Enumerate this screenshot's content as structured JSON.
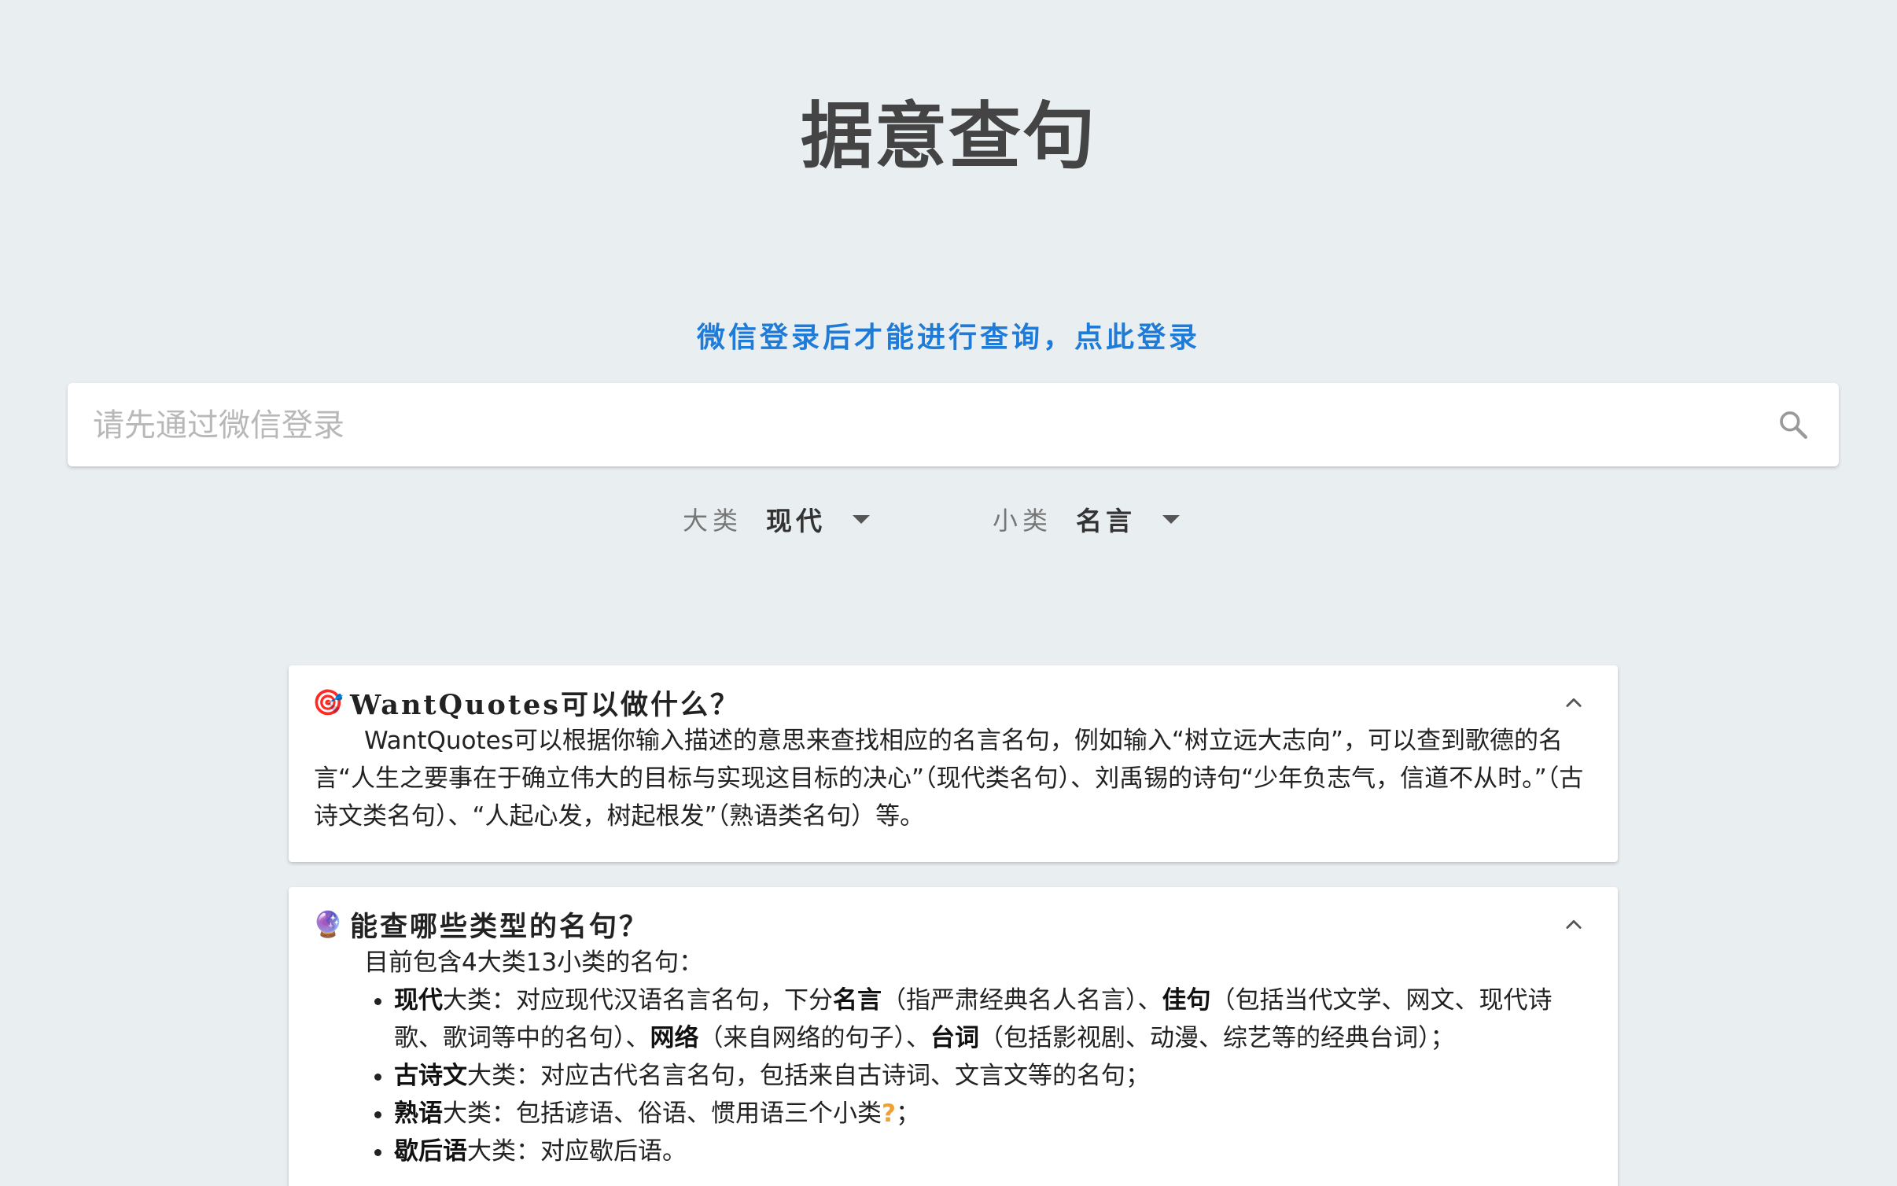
{
  "header": {
    "title": "据意查句",
    "login_prompt": "微信登录后才能进行查询，点此登录"
  },
  "search": {
    "placeholder": "请先通过微信登录",
    "value": ""
  },
  "filters": {
    "category": {
      "label": "大类",
      "value": "现代"
    },
    "subcategory": {
      "label": "小类",
      "value": "名言"
    }
  },
  "cards": {
    "what": {
      "emoji": "🎯",
      "title": "WantQuotes可以做什么？",
      "body": "WantQuotes可以根据你输入描述的意思来查找相应的名言名句，例如输入“树立远大志向”，可以查到歌德的名言“人生之要事在于确立伟大的目标与实现这目标的决心”（现代类名句）、刘禹锡的诗句“少年负志气，信道不从时。”（古诗文类名句）、“人起心发，树起根发”（熟语类名句）等。"
    },
    "types": {
      "emoji": "🔮",
      "title": "能查哪些类型的名句？",
      "intro": "目前包含4大类13小类的名句：",
      "items": [
        {
          "name": "现代",
          "suffix": "大类：对应现代汉语名言名句，下分",
          "s1": "名言",
          "d1": "（指严肃经典名人名言）、",
          "s2": "佳句",
          "d2": "（包括当代文学、网文、现代诗歌、歌词等中的名句）、",
          "s3": "网络",
          "d3": "（来自网络的句子）、",
          "s4": "台词",
          "d4": "（包括影视剧、动漫、综艺等的经典台词）；"
        },
        {
          "name": "古诗文",
          "suffix": "大类：对应古代名言名句，包括来自古诗词、文言文等的名句；"
        },
        {
          "name": "熟语",
          "suffix": "大类：包括谚语、俗语、惯用语三个小类",
          "qmark": "?",
          "tail": "；"
        },
        {
          "name": "歇后语",
          "suffix": "大类：对应歇后语。"
        }
      ]
    }
  },
  "colors": {
    "background": "#e9eef1",
    "link": "#1e7bd8",
    "help": "#f0a030"
  }
}
